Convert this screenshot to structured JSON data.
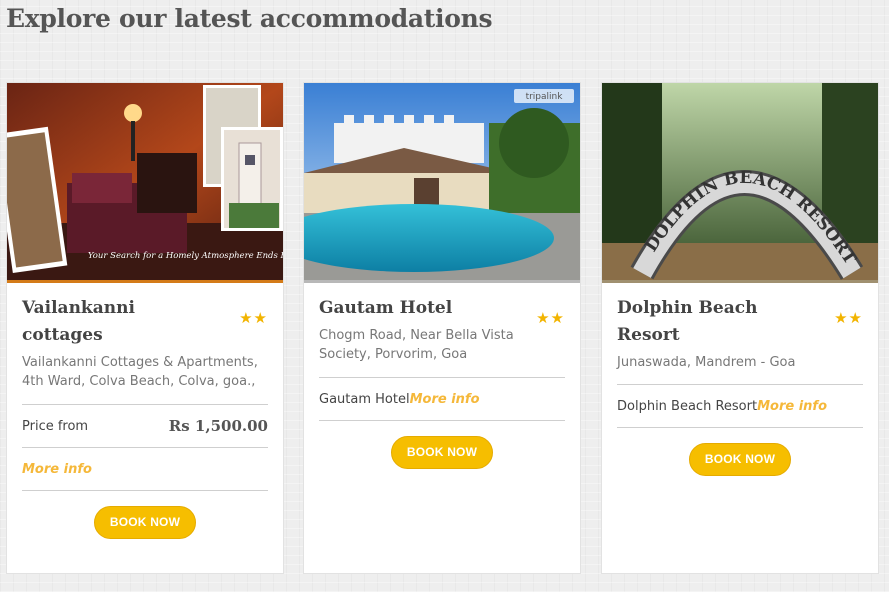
{
  "section": {
    "title": "Explore our latest accommodations"
  },
  "cards": [
    {
      "name": "Vailankanni cottages",
      "stars": "★★",
      "address": "Vailankanni Cottages & Apartments, 4th Ward, Colva Beach, Colva, goa.,",
      "price_label": "Price from",
      "price": "Rs 1,500.00",
      "more_info": "More info",
      "book_label": "BOOK NOW",
      "photo_caption": "Your Search for a Homely Atmosphere Ends Here"
    },
    {
      "name": "Gautam Hotel",
      "stars": "★★",
      "address": "Chogm Road, Near Bella Vista Society, Porvorim, Goa",
      "info_text": "Gautam Hotel",
      "more_info": "More info",
      "book_label": "BOOK NOW",
      "watermark": "tripalink"
    },
    {
      "name": "Dolphin Beach Resort",
      "stars": "★★",
      "address": "Junaswada, Mandrem - Goa",
      "info_text": "Dolphin Beach Resort",
      "more_info": "More info",
      "book_label": "BOOK NOW",
      "sign_text": "DOLPHIN BEACH RESORT"
    }
  ]
}
